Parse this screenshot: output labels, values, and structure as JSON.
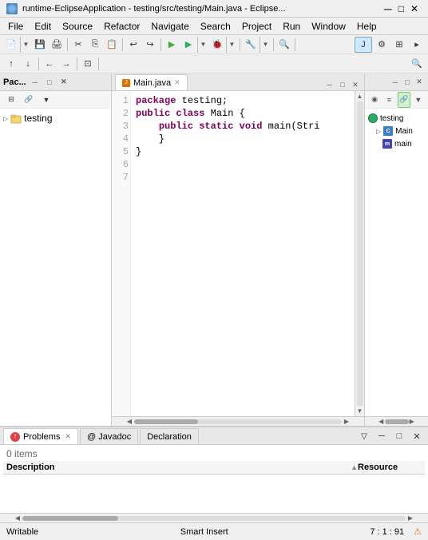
{
  "titlebar": {
    "title": "runtime-EclipseApplication - testing/src/testing/Main.java - Eclipse...",
    "icon": "eclipse-icon"
  },
  "menubar": {
    "items": [
      "File",
      "Edit",
      "Source",
      "Refactor",
      "Navigate",
      "Search",
      "Project",
      "Run",
      "Window",
      "Help"
    ]
  },
  "toolbar1": {
    "buttons": [
      "new",
      "save",
      "print",
      "sep",
      "cut",
      "copy",
      "paste",
      "sep",
      "undo",
      "redo",
      "sep",
      "search",
      "run",
      "debug",
      "sep",
      "marker",
      "sep"
    ]
  },
  "toolbar2": {
    "buttons": [
      "prev",
      "next",
      "sep",
      "back",
      "forward",
      "sep",
      "hierarchy"
    ]
  },
  "perspectives": {
    "search_icon": "🔍",
    "icons": [
      "java",
      "debug",
      "git"
    ]
  },
  "package_explorer": {
    "title": "Pac...",
    "items": [
      {
        "label": "testing",
        "type": "project",
        "expanded": true
      }
    ]
  },
  "editor": {
    "tab_label": "Main.java",
    "filename": "Main.java",
    "lines": [
      {
        "num": 1,
        "code": "package testing;"
      },
      {
        "num": 2,
        "code": ""
      },
      {
        "num": 3,
        "code": "public class Main {"
      },
      {
        "num": 4,
        "code": "    public static void main(Stri"
      },
      {
        "num": 5,
        "code": "    }"
      },
      {
        "num": 6,
        "code": "}"
      },
      {
        "num": 7,
        "code": ""
      }
    ]
  },
  "outline": {
    "items": [
      {
        "label": "testing",
        "type": "project"
      },
      {
        "label": "Main",
        "type": "class"
      },
      {
        "label": "main",
        "type": "method"
      }
    ]
  },
  "bottom": {
    "tabs": [
      {
        "label": "Problems",
        "active": true
      },
      {
        "label": "@ Javadoc",
        "active": false
      },
      {
        "label": "Declaration",
        "active": false
      }
    ],
    "items_count": "0 items",
    "headers": [
      "Description",
      "Resource"
    ]
  },
  "statusbar": {
    "writable": "Writable",
    "insert": "Smart Insert",
    "position": "7 : 1 : 91",
    "warning": "⚠"
  }
}
